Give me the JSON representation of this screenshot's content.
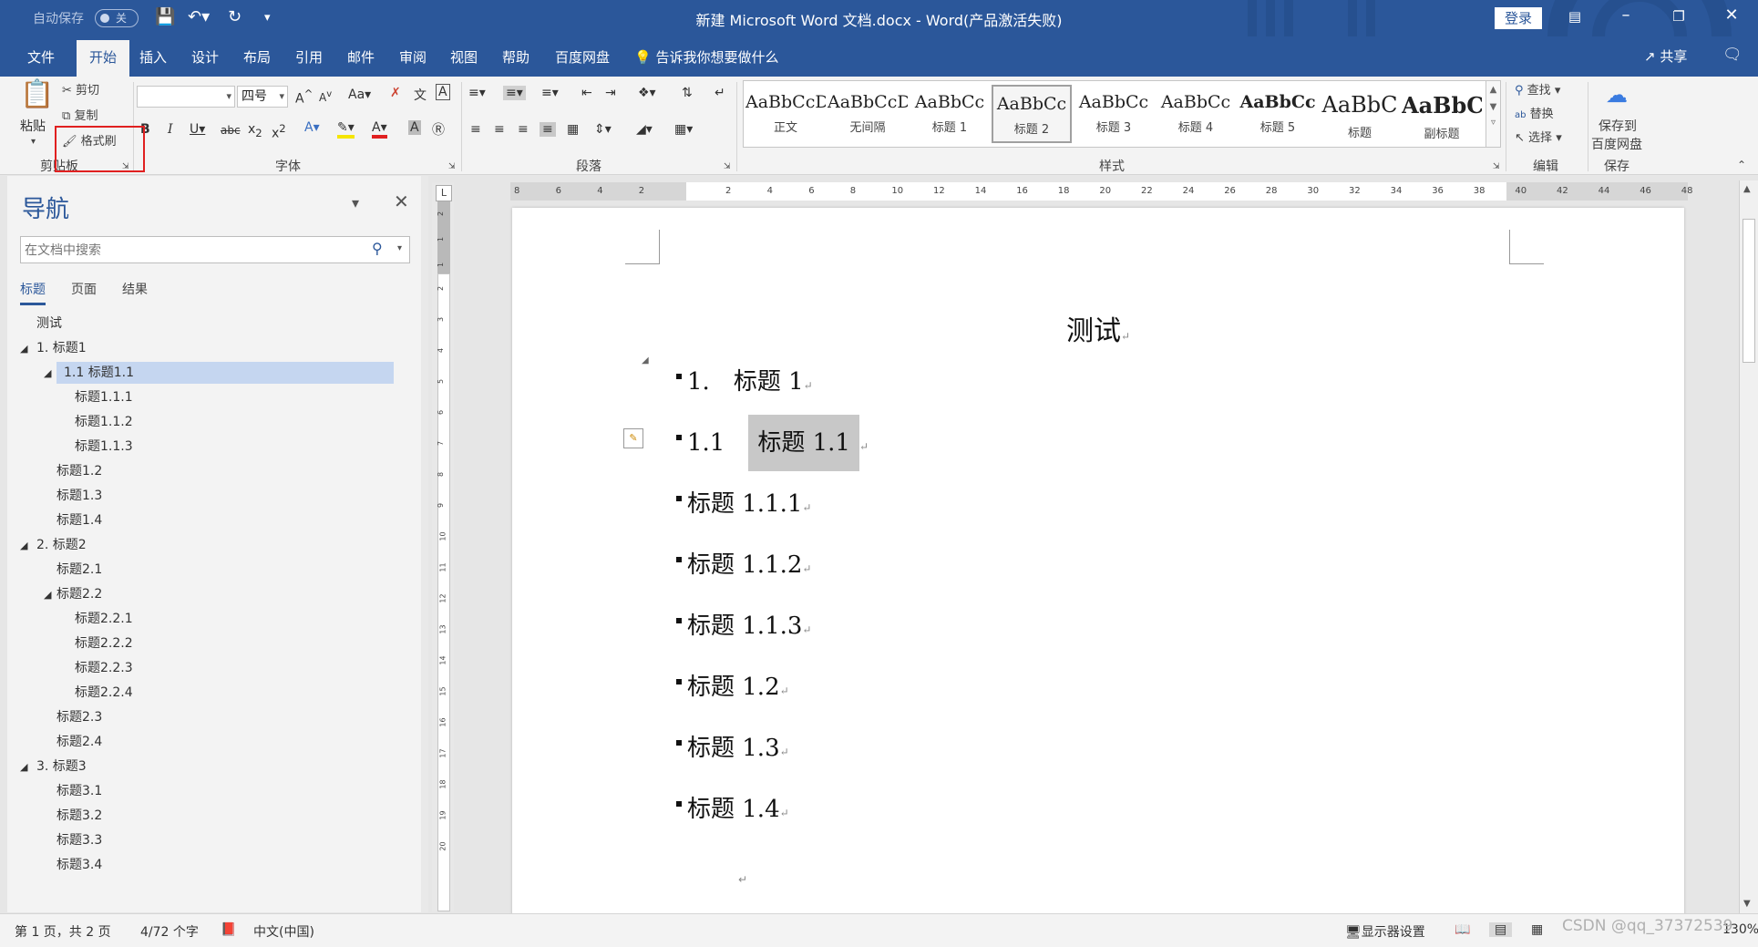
{
  "titlebar": {
    "autosave_label": "自动保存",
    "autosave_state": "关",
    "window_title": "新建 Microsoft Word 文档.docx  -  Word(产品激活失败)",
    "login_label": "登录"
  },
  "ribbon_tabs": [
    "文件",
    "开始",
    "插入",
    "设计",
    "布局",
    "引用",
    "邮件",
    "审阅",
    "视图",
    "帮助",
    "百度网盘"
  ],
  "tell_me": "告诉我你想要做什么",
  "share": "共享",
  "clipboard": {
    "paste": "粘贴",
    "cut": "剪切",
    "copy": "复制",
    "format_painter": "格式刷",
    "group_label": "剪贴板"
  },
  "font": {
    "font_name": "",
    "font_size": "四号",
    "group_label": "字体"
  },
  "paragraph": {
    "group_label": "段落"
  },
  "styles": {
    "group_label": "样式",
    "items": [
      {
        "sample": "AaBbCcDc",
        "name": "正文"
      },
      {
        "sample": "AaBbCcDc",
        "name": "无间隔"
      },
      {
        "sample": "AaBbCc",
        "name": "标题 1"
      },
      {
        "sample": "AaBbCc",
        "name": "标题 2"
      },
      {
        "sample": "AaBbCc",
        "name": "标题 3"
      },
      {
        "sample": "AaBbCc",
        "name": "标题 4"
      },
      {
        "sample": "AaBbCc",
        "name": "标题 5"
      },
      {
        "sample": "AaBbC",
        "name": "标题"
      },
      {
        "sample": "AaBbC",
        "name": "副标题"
      }
    ],
    "selected_index": 3
  },
  "editing": {
    "find": "查找",
    "replace": "替换",
    "select": "选择",
    "group_label": "编辑"
  },
  "save": {
    "save_to_line1": "保存到",
    "save_to_line2": "百度网盘",
    "group_label": "保存"
  },
  "nav": {
    "title": "导航",
    "search_placeholder": "在文档中搜索",
    "tabs": [
      "标题",
      "页面",
      "结果"
    ],
    "items": [
      {
        "text": "测试",
        "level": 0,
        "tri": false
      },
      {
        "text": "1. 标题1",
        "level": 0,
        "tri": true
      },
      {
        "text": "1.1 标题1.1",
        "level": 1,
        "tri": true,
        "selected": true
      },
      {
        "text": "标题1.1.1",
        "level": 2,
        "tri": false
      },
      {
        "text": "标题1.1.2",
        "level": 2,
        "tri": false
      },
      {
        "text": "标题1.1.3",
        "level": 2,
        "tri": false
      },
      {
        "text": "标题1.2",
        "level": 1,
        "tri": false
      },
      {
        "text": "标题1.3",
        "level": 1,
        "tri": false
      },
      {
        "text": "标题1.4",
        "level": 1,
        "tri": false
      },
      {
        "text": "2. 标题2",
        "level": 0,
        "tri": true
      },
      {
        "text": "标题2.1",
        "level": 1,
        "tri": false
      },
      {
        "text": "标题2.2",
        "level": 1,
        "tri": true
      },
      {
        "text": "标题2.2.1",
        "level": 2,
        "tri": false
      },
      {
        "text": "标题2.2.2",
        "level": 2,
        "tri": false
      },
      {
        "text": "标题2.2.3",
        "level": 2,
        "tri": false
      },
      {
        "text": "标题2.2.4",
        "level": 2,
        "tri": false
      },
      {
        "text": "标题2.3",
        "level": 1,
        "tri": false
      },
      {
        "text": "标题2.4",
        "level": 1,
        "tri": false
      },
      {
        "text": "3. 标题3",
        "level": 0,
        "tri": true
      },
      {
        "text": "标题3.1",
        "level": 1,
        "tri": false
      },
      {
        "text": "标题3.2",
        "level": 1,
        "tri": false
      },
      {
        "text": "标题3.3",
        "level": 1,
        "tri": false
      },
      {
        "text": "标题3.4",
        "level": 1,
        "tri": false
      }
    ]
  },
  "ruler": {
    "h_left": [
      "8",
      "6",
      "4",
      "2"
    ],
    "h_right": [
      "2",
      "4",
      "6",
      "8",
      "10",
      "12",
      "14",
      "16",
      "18",
      "20",
      "22",
      "24",
      "26",
      "28",
      "30",
      "32",
      "34",
      "36",
      "38",
      "40",
      "42",
      "44",
      "46",
      "48"
    ],
    "v": [
      "2",
      "1",
      "1",
      "2",
      "3",
      "4",
      "5",
      "6",
      "7",
      "8",
      "9",
      "10",
      "11",
      "12",
      "13",
      "14",
      "15",
      "16",
      "17",
      "18",
      "19",
      "20"
    ],
    "corner": "L"
  },
  "document": {
    "title": "测试",
    "paragraphs": [
      {
        "num": "1.",
        "text": "标题 1"
      },
      {
        "num": "1.1",
        "text": "标题 1.1",
        "highlight": true
      },
      {
        "num": "",
        "text": "标题 1.1.1"
      },
      {
        "num": "",
        "text": "标题 1.1.2"
      },
      {
        "num": "",
        "text": "标题 1.1.3"
      },
      {
        "num": "",
        "text": "标题 1.2"
      },
      {
        "num": "",
        "text": "标题 1.3"
      },
      {
        "num": "",
        "text": "标题 1.4"
      }
    ],
    "paragraph_mark": "↵"
  },
  "status": {
    "page": "第 1 页，共 2 页",
    "words": "4/72 个字",
    "language": "中文(中国)",
    "display_settings": "显示器设置",
    "zoom": "130%"
  },
  "watermark": "CSDN @qq_37372539",
  "colors": {
    "accent": "#2b579a",
    "highlight_box": "#e02020",
    "nav_selected": "#c5d6f0"
  }
}
